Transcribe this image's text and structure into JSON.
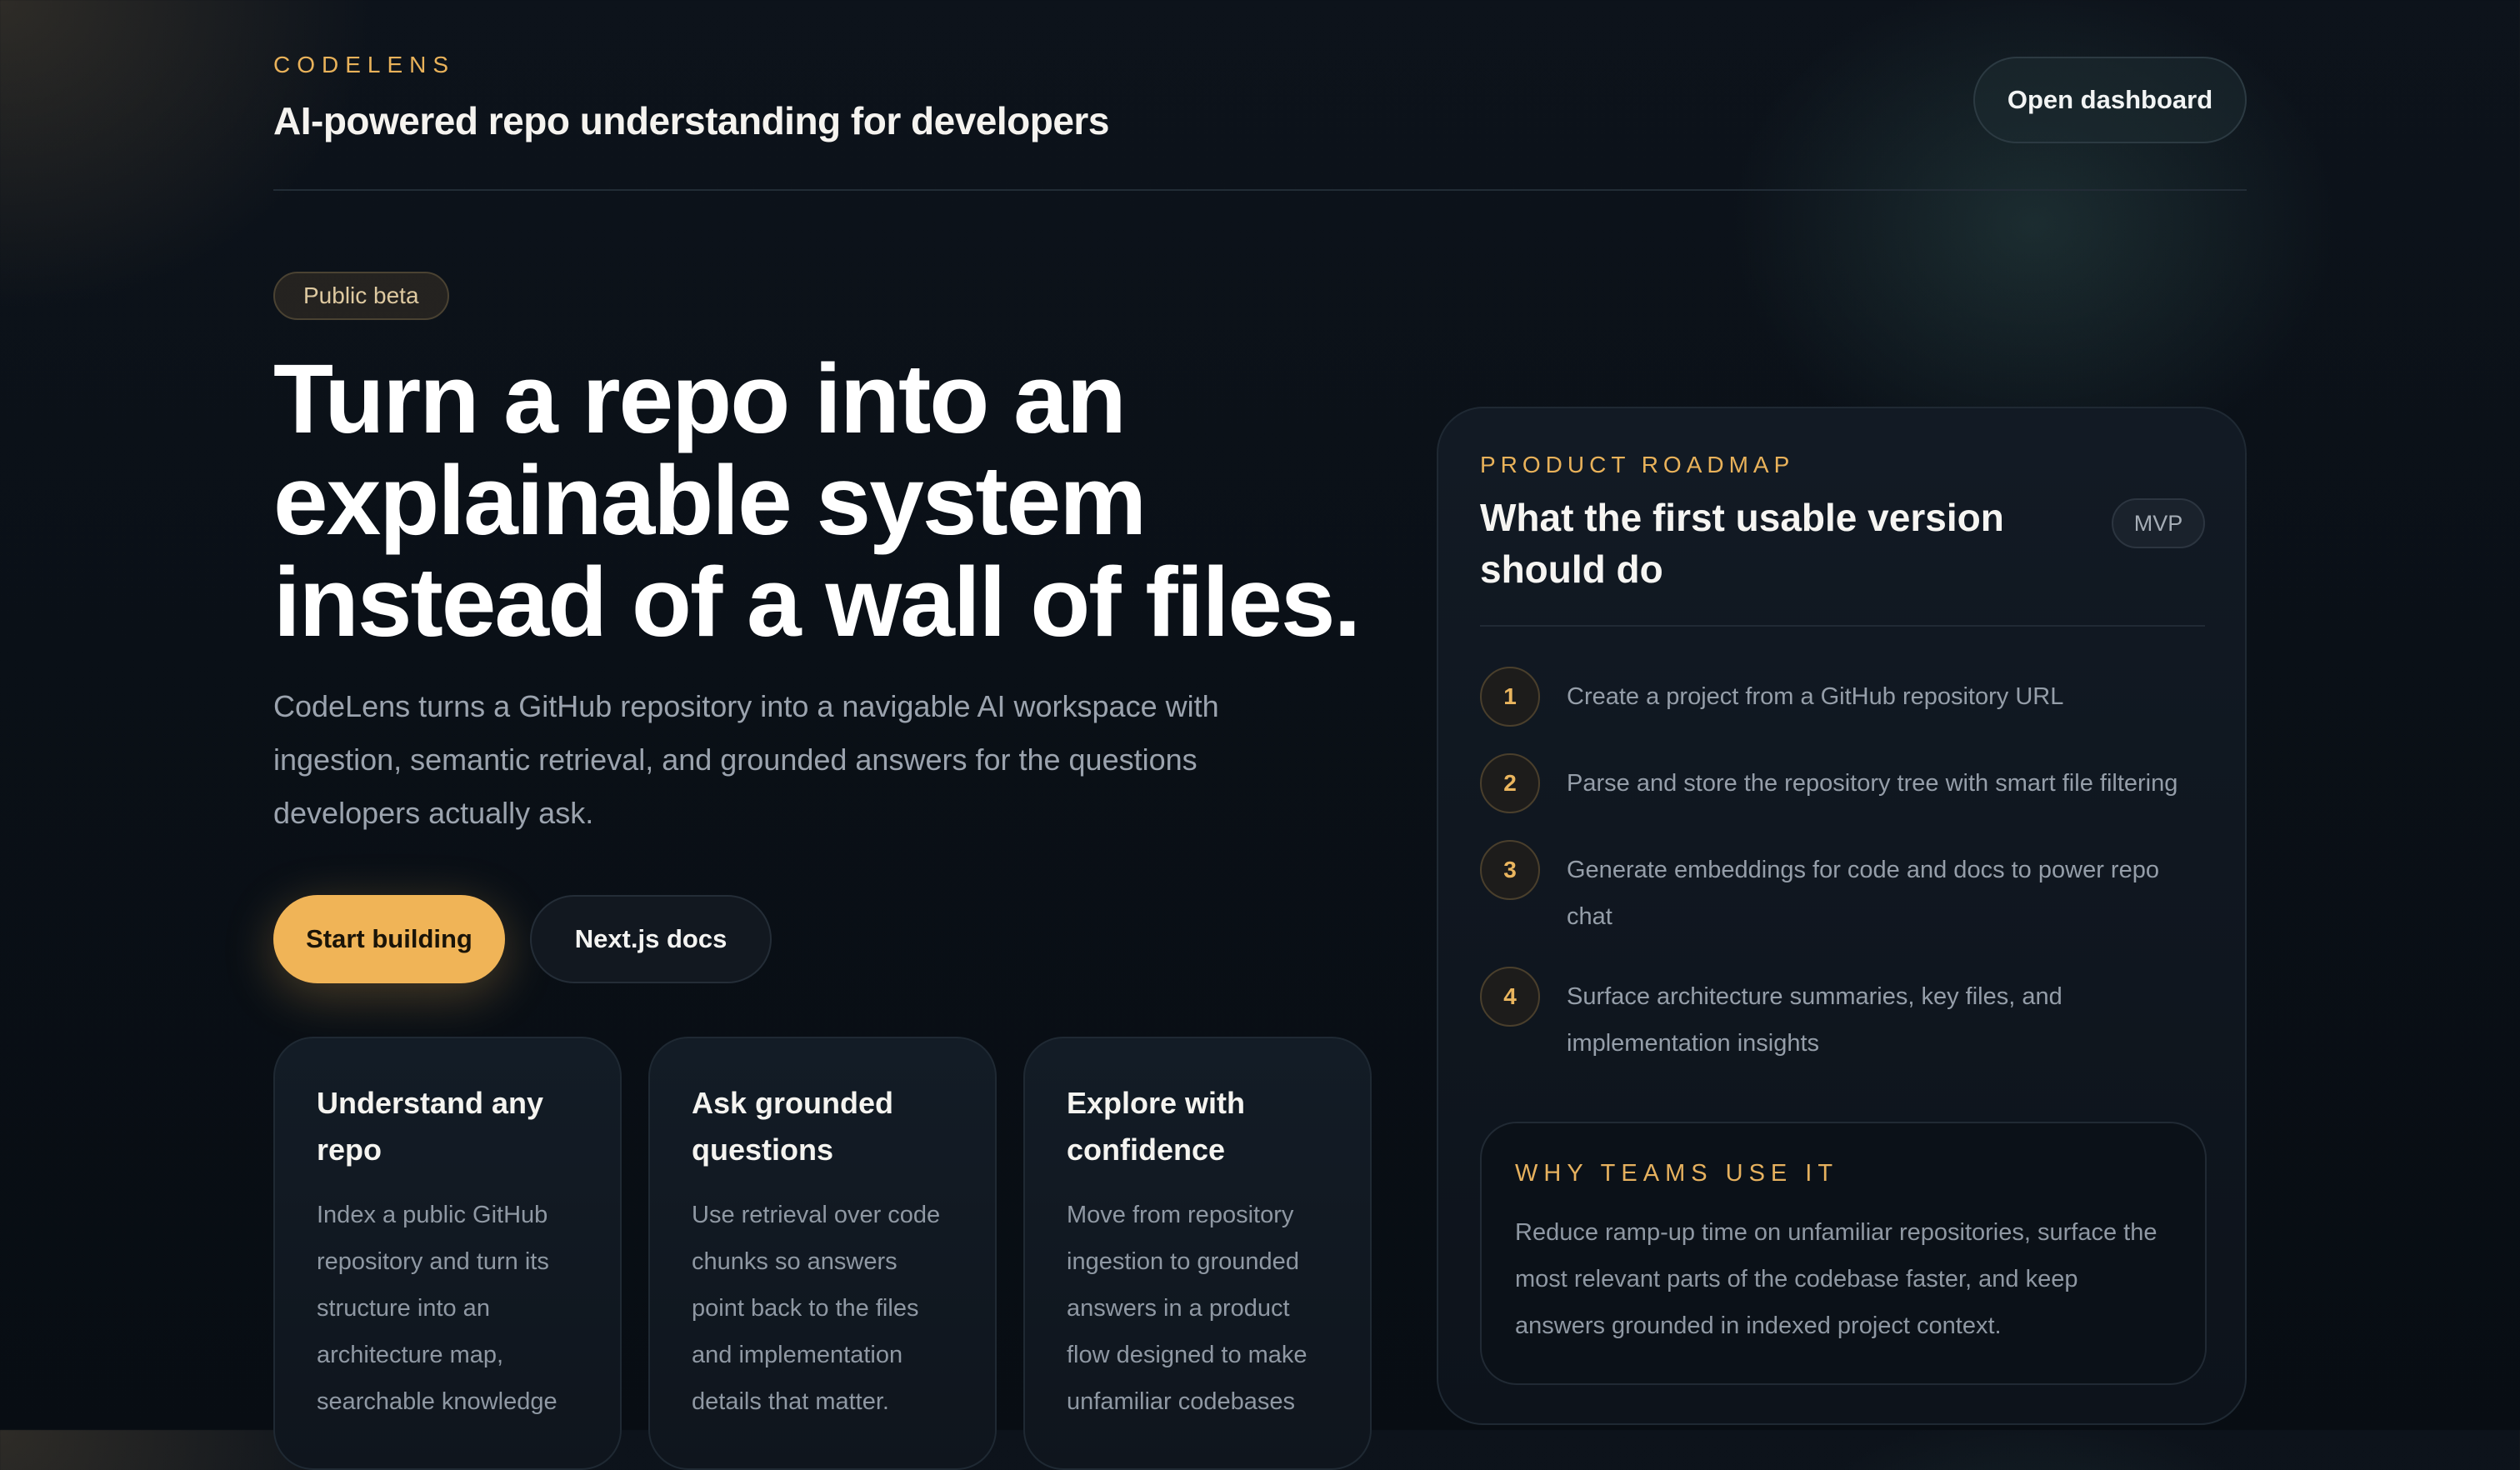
{
  "header": {
    "brand": "CODELENS",
    "tagline": "AI-powered repo understanding for developers",
    "open_dashboard": "Open dashboard"
  },
  "hero": {
    "badge": "Public beta",
    "headline_lines": [
      "Turn a repo into an",
      "explainable system",
      "instead of a wall of files."
    ],
    "subtext": "CodeLens turns a GitHub repository into a navigable AI workspace with ingestion, semantic retrieval, and grounded answers for the questions developers actually ask.",
    "primary_cta": "Start building",
    "secondary_cta": "Next.js docs"
  },
  "features": [
    {
      "title": "Understand any repo",
      "body": "Index a public GitHub repository and turn its structure into an architecture map, searchable knowledge"
    },
    {
      "title": "Ask grounded questions",
      "body": "Use retrieval over code chunks so answers point back to the files and implementation details that matter."
    },
    {
      "title": "Explore with confidence",
      "body": "Move from repository ingestion to grounded answers in a product flow designed to make unfamiliar codebases"
    }
  ],
  "roadmap": {
    "eyebrow": "PRODUCT ROADMAP",
    "title": "What the first usable version should do",
    "badge": "MVP",
    "steps": [
      {
        "num": "1",
        "text": "Create a project from a GitHub repository URL"
      },
      {
        "num": "2",
        "text": "Parse and store the repository tree with smart file filtering"
      },
      {
        "num": "3",
        "text": "Generate embeddings for code and docs to power repo chat"
      },
      {
        "num": "4",
        "text": "Surface architecture summaries, key files, and implementation insights"
      }
    ],
    "why": {
      "title": "WHY TEAMS USE IT",
      "text": "Reduce ramp-up time on unfamiliar repositories, surface the most relevant parts of the codebase faster, and keep answers grounded in indexed project context."
    }
  },
  "colors": {
    "accent": "#f0b457",
    "background": "#0a1017",
    "muted_text": "#959ea9"
  }
}
